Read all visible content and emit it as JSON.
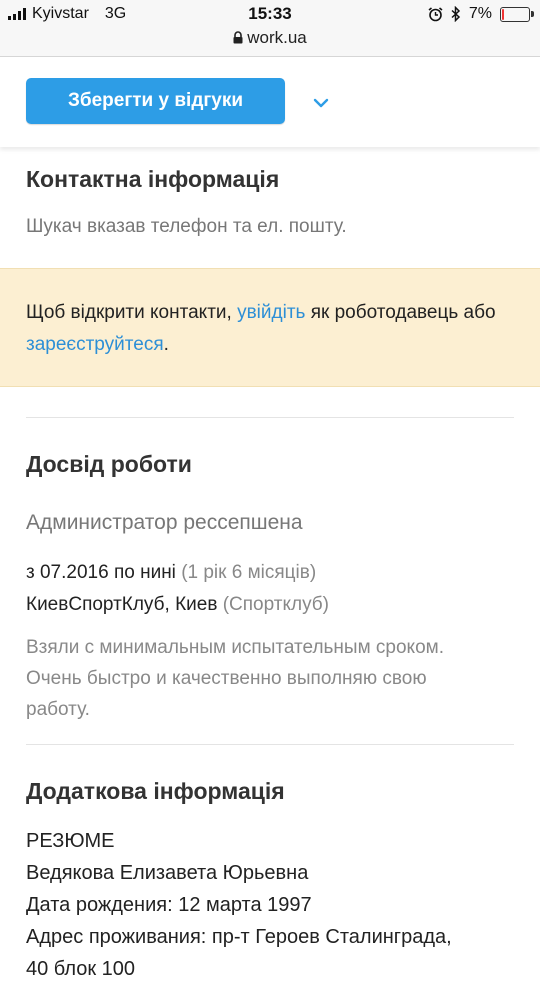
{
  "status_bar": {
    "carrier": "Kyivstar",
    "network": "3G",
    "time": "15:33",
    "url": "work.ua",
    "battery": "7%",
    "battery_level": 0.07,
    "icons": [
      "signal-icon",
      "lock-icon",
      "alarm-icon",
      "bluetooth-icon",
      "battery-icon"
    ]
  },
  "toolbar": {
    "save_label": "Зберегти у відгуки",
    "dropdown_icon": "chevron-down-icon"
  },
  "contacts": {
    "title": "Контактна інформація",
    "subtitle": "Шукач вказав телефон та ел. пошту.",
    "notice_text_1": "Щоб відкрити контакти, ",
    "login_link": "увійдіть",
    "notice_text_2": " як роботодавець або ",
    "register_link": "зареєструйтеся",
    "notice_text_3": "."
  },
  "experience": {
    "title": "Досвід роботи",
    "position": "Администратор рессепшена",
    "period": "з 07.2016 по нині",
    "duration": "(1 рік 6 місяців)",
    "company": "КиевСпортКлуб, Киев",
    "industry": "(Спортклуб)",
    "description_lines": [
      "Взяли с минимальным испытательным сроком.",
      "Очень быстро и качественно выполняю свою",
      "работу."
    ]
  },
  "additional": {
    "title": "Додаткова інформація",
    "lines": [
      "РЕЗЮМЕ",
      "Ведякова Елизавета Юрьевна",
      "Дата рождения: 12 марта 1997",
      "Адрес проживания: пр-т Героев Сталинграда,",
      "40 блок 100"
    ]
  },
  "colors": {
    "accent": "#2d9de6",
    "link": "#2d8fd6",
    "notice_bg": "#fcefd2"
  }
}
